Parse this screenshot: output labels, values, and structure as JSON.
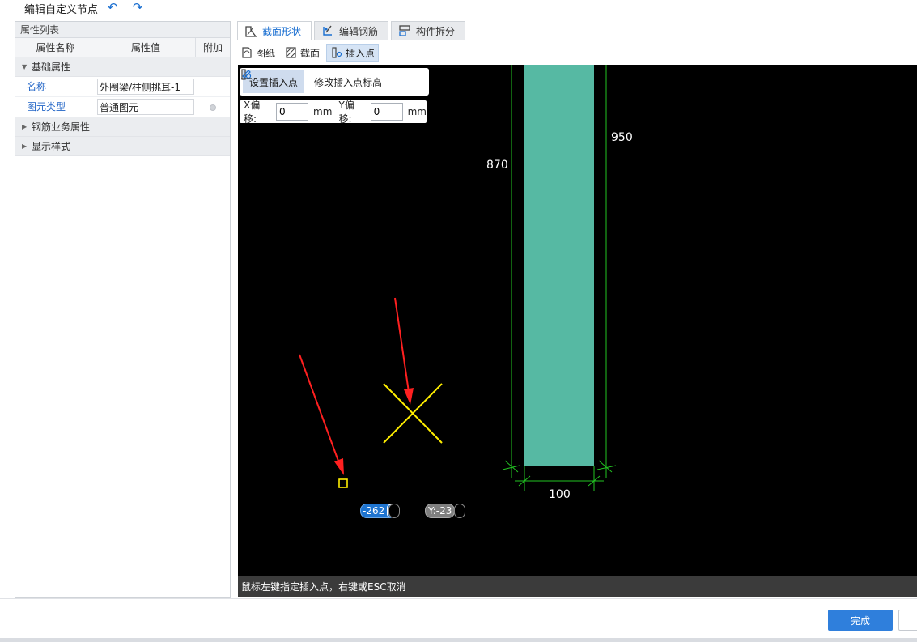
{
  "window": {
    "title": "编辑自定义节点"
  },
  "left_panel": {
    "header": "属性列表",
    "columns": [
      "属性名称",
      "属性值",
      "附加"
    ],
    "groups": [
      {
        "label": "基础属性",
        "expanded": true,
        "rows": [
          {
            "name": "名称",
            "value": "外圈梁/柱侧挑耳-1"
          },
          {
            "name": "图元类型",
            "value": "普通图元"
          }
        ]
      },
      {
        "label": "钢筋业务属性",
        "expanded": false
      },
      {
        "label": "显示样式",
        "expanded": false
      }
    ]
  },
  "tabs": [
    {
      "label": "截面形状",
      "icon": "section-shape-icon",
      "active": true
    },
    {
      "label": "编辑钢筋",
      "icon": "edit-rebar-icon",
      "active": false
    },
    {
      "label": "构件拆分",
      "icon": "component-split-icon",
      "active": false
    }
  ],
  "subtoolbar": [
    {
      "label": "图纸",
      "icon": "drawing-icon",
      "active": false
    },
    {
      "label": "截面",
      "icon": "section-icon",
      "active": false
    },
    {
      "label": "插入点",
      "icon": "insert-point-icon",
      "active": true
    }
  ],
  "insert_tools": {
    "set_point": "设置插入点",
    "modify_height": "修改插入点标高"
  },
  "offset": {
    "x_label": "X偏移:",
    "x_value": "0",
    "y_label": "Y偏移:",
    "y_value": "0",
    "unit": "mm"
  },
  "drawing": {
    "dim_left": "870",
    "dim_right": "950",
    "dim_bottom": "100",
    "coord_x": "-262",
    "coord_y": "Y:-23",
    "colors": {
      "column_fill": "#56b9a3",
      "dimension_lines": "#22c322",
      "cross_marker": "#ffee00",
      "annotation_arrow": "#ff2020"
    }
  },
  "status": "鼠标左键指定插入点，右键或ESC取消",
  "footer": {
    "done_label": "完成"
  }
}
